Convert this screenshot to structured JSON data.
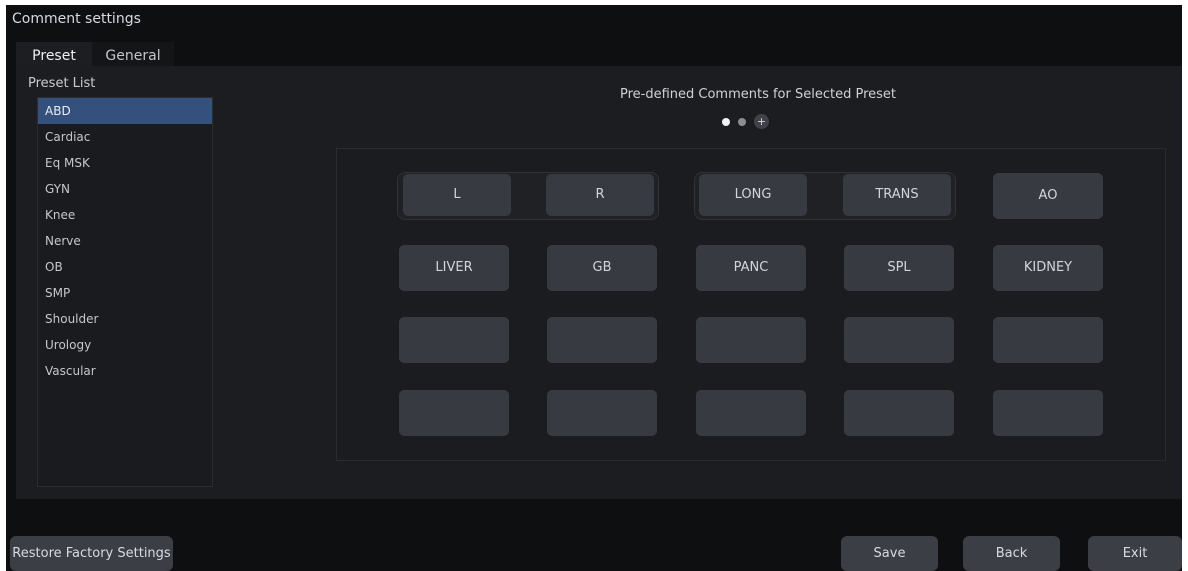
{
  "window": {
    "title": "Comment settings"
  },
  "tabs": [
    {
      "label": "Preset",
      "active": true
    },
    {
      "label": "General",
      "active": false
    }
  ],
  "preset_list": {
    "label": "Preset List",
    "items": [
      "ABD",
      "Cardiac",
      "Eq MSK",
      "GYN",
      "Knee",
      "Nerve",
      "OB",
      "SMP",
      "Shoulder",
      "Urology",
      "Vascular"
    ],
    "selected": "ABD"
  },
  "comments": {
    "title": "Pre-defined Comments for Selected Preset",
    "page_indicator": {
      "pages": 2,
      "current": 1,
      "add_symbol": "+"
    },
    "rows": [
      [
        "L",
        "R",
        "LONG",
        "TRANS",
        "AO"
      ],
      [
        "LIVER",
        "GB",
        "PANC",
        "SPL",
        "KIDNEY"
      ],
      [
        "",
        "",
        "",
        "",
        ""
      ],
      [
        "",
        "",
        "",
        "",
        ""
      ]
    ]
  },
  "buttons": {
    "restore": "Restore Factory Settings",
    "save": "Save",
    "back": "Back",
    "exit": "Exit"
  },
  "colors": {
    "selected_item": "#34507c",
    "button": "#373a40",
    "background": "#0e0f11",
    "panel": "#1c1d20"
  }
}
